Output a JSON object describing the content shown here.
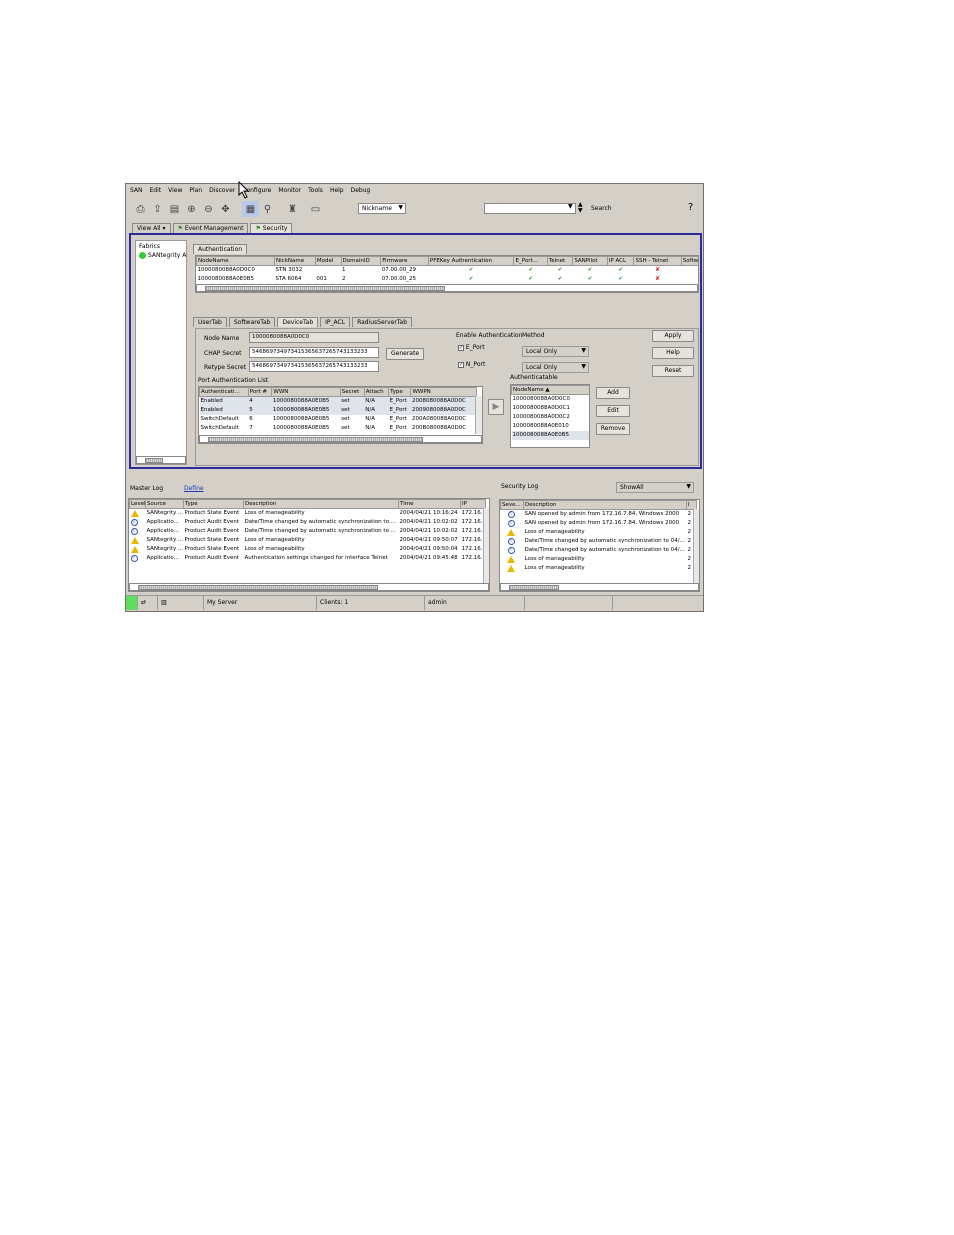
{
  "menu": [
    "SAN",
    "Edit",
    "View",
    "Plan",
    "Discover",
    "Configure",
    "Monitor",
    "Tools",
    "Help",
    "Debug"
  ],
  "toolbar": {
    "nickname_select": "Nickname",
    "search_label": "Search",
    "help_glyph": "?"
  },
  "view_tabs": [
    "View All",
    "Event Management",
    "Security"
  ],
  "fabrics": {
    "title": "Fabrics",
    "item": "SANtegrity A"
  },
  "auth_tab": "Authentication",
  "auth_table": {
    "headers": [
      "NodeName",
      "NickName",
      "Model",
      "DomainID",
      "Firmware",
      "PFEKey Authentication",
      "E_Port...",
      "Telnet",
      "SANPilot",
      "IP ACL",
      "SSH - Telnet",
      "Softw"
    ],
    "rows": [
      [
        "1000080088A0D0C0",
        "STN 3032",
        "",
        "1",
        "07.00.00_29"
      ],
      [
        "1000080088A0E0B5",
        "STA 6064",
        "001",
        "2",
        "07.00.00_25"
      ]
    ]
  },
  "device_tabs": [
    "UserTab",
    "SoftwareTab",
    "DeviceTab",
    "IP_ACL",
    "RadiusServerTab"
  ],
  "device_form": {
    "node_name_label": "Node Name",
    "node_name": "1000080088A0D0C0",
    "chap_label": "CHAP Secret",
    "chap": "546869734973415365637265743133233",
    "retype_label": "Retype Secret",
    "retype": "546869734973415365637265743133233",
    "generate": "Generate",
    "enable_auth": "Enable Authentication",
    "method": "Method",
    "eport": "E_Port",
    "nport": "N_Port",
    "local_only": "Local Only",
    "apply": "Apply",
    "help": "Help",
    "reset": "Reset"
  },
  "port_list": {
    "title": "Port Authentication List",
    "headers": [
      "Authenticati...",
      "Port #",
      "WWN",
      "Secret",
      "Attach",
      "Type",
      "WWPN"
    ],
    "rows": [
      [
        "Enabled",
        "4",
        "1000080088A0E0B5",
        "set",
        "N/A",
        "E_Port",
        "2008080088A0D0C"
      ],
      [
        "Enabled",
        "5",
        "1000080088A0E0B5",
        "set",
        "N/A",
        "E_Port",
        "2009080088A0D0C"
      ],
      [
        "SwitchDefault",
        "6",
        "1000080088A0E0B5",
        "set",
        "N/A",
        "E_Port",
        "200A080088A0D0C"
      ],
      [
        "SwitchDefault",
        "7",
        "1000080088A0E0B5",
        "set",
        "N/A",
        "E_Port",
        "200B080088A0D0C"
      ]
    ]
  },
  "authenticatable": {
    "title": "Authenticatable",
    "header": "NodeName",
    "items": [
      "1000080088A0D0C0",
      "1000080088A0D0C1",
      "1000080088A0D0C2",
      "1000080088A0E010",
      "1000080088A0E0B5"
    ],
    "add": "Add",
    "edit": "Edit",
    "remove": "Remove"
  },
  "master_log": {
    "title": "Master Log",
    "define": "Define",
    "headers": [
      "Level",
      "Source",
      "Type",
      "Description",
      "Time",
      "IP"
    ],
    "rows": [
      {
        "icon": "warn",
        "source": "SANtegrity ...",
        "type": "Product State Event",
        "desc": "Loss of manageability",
        "time": "2004/04/21 10:16:24",
        "ip": "172.16.2"
      },
      {
        "icon": "info",
        "source": "Applicatio...",
        "type": "Product Audit Event",
        "desc": "Date/Time changed by automatic synchronization to ...",
        "time": "2004/04/21 10:02:02",
        "ip": "172.16.2"
      },
      {
        "icon": "info",
        "source": "Applicatio...",
        "type": "Product Audit Event",
        "desc": "Date/Time changed by automatic synchronization to ...",
        "time": "2004/04/21 10:02:02",
        "ip": "172.16.2"
      },
      {
        "icon": "warn",
        "source": "SANtegrity ...",
        "type": "Product State Event",
        "desc": "Loss of manageability",
        "time": "2004/04/21 09:50:07",
        "ip": "172.16.2"
      },
      {
        "icon": "warn",
        "source": "SANtegrity ...",
        "type": "Product State Event",
        "desc": "Loss of manageability",
        "time": "2004/04/21 09:50:04",
        "ip": "172.16.2"
      },
      {
        "icon": "info",
        "source": "Applicatio...",
        "type": "Product Audit Event",
        "desc": "Authentication settings changed for interface Telnet",
        "time": "2004/04/21 09:45:48",
        "ip": "172.16.2"
      }
    ]
  },
  "security_log": {
    "title": "Security Log",
    "show": "ShowAll",
    "headers": [
      "Seve...",
      "Description",
      "I"
    ],
    "rows": [
      {
        "icon": "info",
        "desc": "SAN opened by admin from 172.16.7.84, Windows 2000",
        "t": "2"
      },
      {
        "icon": "info",
        "desc": "SAN opened by admin from 172.16.7.84, Windows 2000",
        "t": "2"
      },
      {
        "icon": "warn",
        "desc": "Loss of manageability",
        "t": "2"
      },
      {
        "icon": "info",
        "desc": "Date/Time changed by automatic synchronization to 04/...",
        "t": "2"
      },
      {
        "icon": "info",
        "desc": "Date/Time changed by automatic synchronization to 04/...",
        "t": "2"
      },
      {
        "icon": "warn",
        "desc": "Loss of manageability",
        "t": "2"
      },
      {
        "icon": "warn",
        "desc": "Loss of manageability",
        "t": "2"
      }
    ]
  },
  "status": {
    "server": "My Server",
    "clients": "Clients: 1",
    "user": "admin"
  }
}
